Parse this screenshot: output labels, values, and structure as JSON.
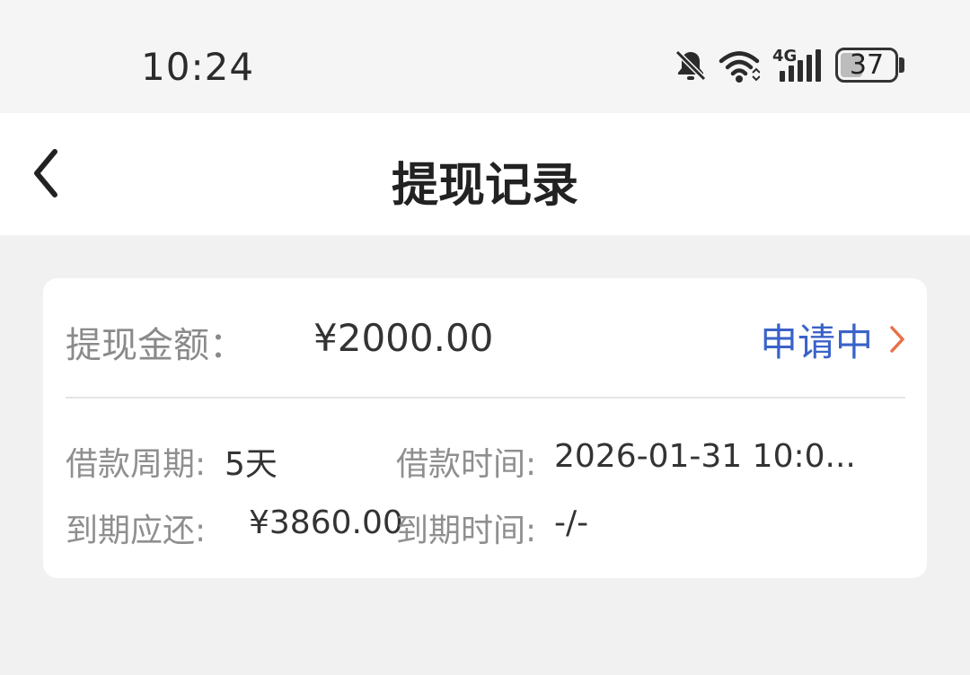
{
  "status_bar": {
    "time": "10:24",
    "network": "4G",
    "battery": "37",
    "icons": [
      "bell-muted-icon",
      "wifi-icon",
      "signal-icon",
      "battery-icon"
    ]
  },
  "nav": {
    "title": "提现记录",
    "back_icon": "chevron-left-icon"
  },
  "record": {
    "amount_label": "提现金额：",
    "amount": "¥2000.00",
    "status": "申请中",
    "status_color": "#3a62c8",
    "chevron_color": "#e8704a",
    "loan_period_label": "借款周期:",
    "loan_period": "5天",
    "loan_time_label": "借款时间:",
    "loan_time": "2026-01-31 10:0...",
    "due_amount_label": "到期应还:",
    "due_amount": "¥3860.00",
    "due_time_label": "到期时间:",
    "due_time": "-/-"
  }
}
